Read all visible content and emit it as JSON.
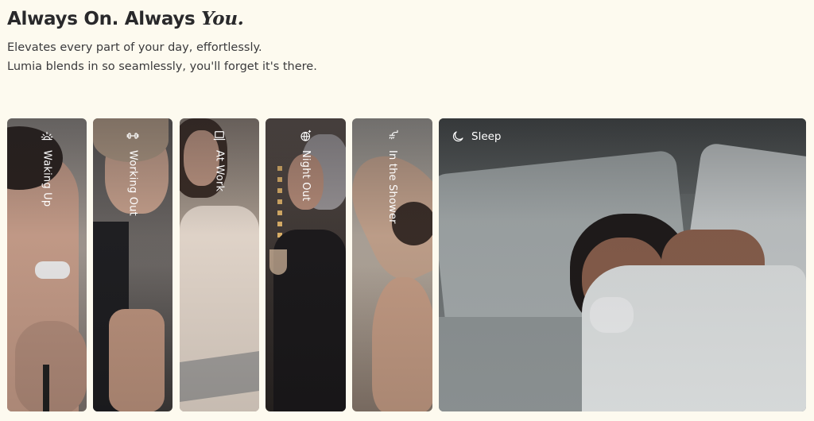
{
  "heading": {
    "prefix": "Always On. Always ",
    "accent": "You."
  },
  "subtext": {
    "line1": "Elevates every part of your day, effortlessly.",
    "line2": "Lumia blends in so seamlessly, you'll forget it's there."
  },
  "panels": [
    {
      "label": "Waking Up",
      "icon": "sunrise-icon"
    },
    {
      "label": "Working Out",
      "icon": "dumbbell-icon"
    },
    {
      "label": "At Work",
      "icon": "laptop-icon"
    },
    {
      "label": "Night Out",
      "icon": "disco-ball-icon"
    },
    {
      "label": "In the Shower",
      "icon": "shower-icon"
    },
    {
      "label": "Sleep",
      "icon": "moon-icon"
    }
  ],
  "colors": {
    "background": "#fdfaef",
    "heading": "#29292b",
    "label": "#ffffff"
  }
}
